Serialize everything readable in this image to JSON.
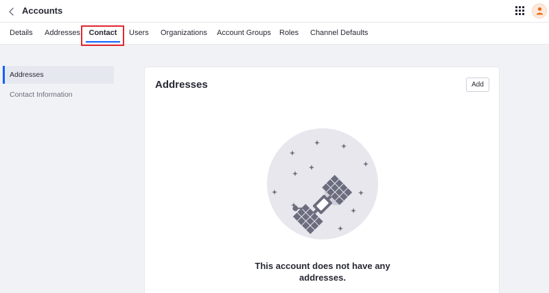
{
  "header": {
    "title": "Accounts",
    "back_icon": "chevron-left-icon",
    "apps_icon": "grid-icon",
    "avatar_icon": "user-icon",
    "avatar_color": "#e86a17"
  },
  "tabs": [
    {
      "label": "Details"
    },
    {
      "label": "Addresses"
    },
    {
      "label": "Contact",
      "active": true
    },
    {
      "label": "Users"
    },
    {
      "label": "Organizations"
    },
    {
      "label": "Account Groups"
    },
    {
      "label": "Roles"
    },
    {
      "label": "Channel Defaults"
    }
  ],
  "sidebar": {
    "items": [
      {
        "label": "Addresses",
        "active": true
      },
      {
        "label": "Contact Information"
      }
    ]
  },
  "card": {
    "title": "Addresses",
    "add_label": "Add",
    "empty_message": "This account does not have any addresses.",
    "illustration": "satellite-icon"
  },
  "colors": {
    "accent": "#0b5fff",
    "highlight": "#e0262d",
    "background": "#f1f2f5"
  }
}
